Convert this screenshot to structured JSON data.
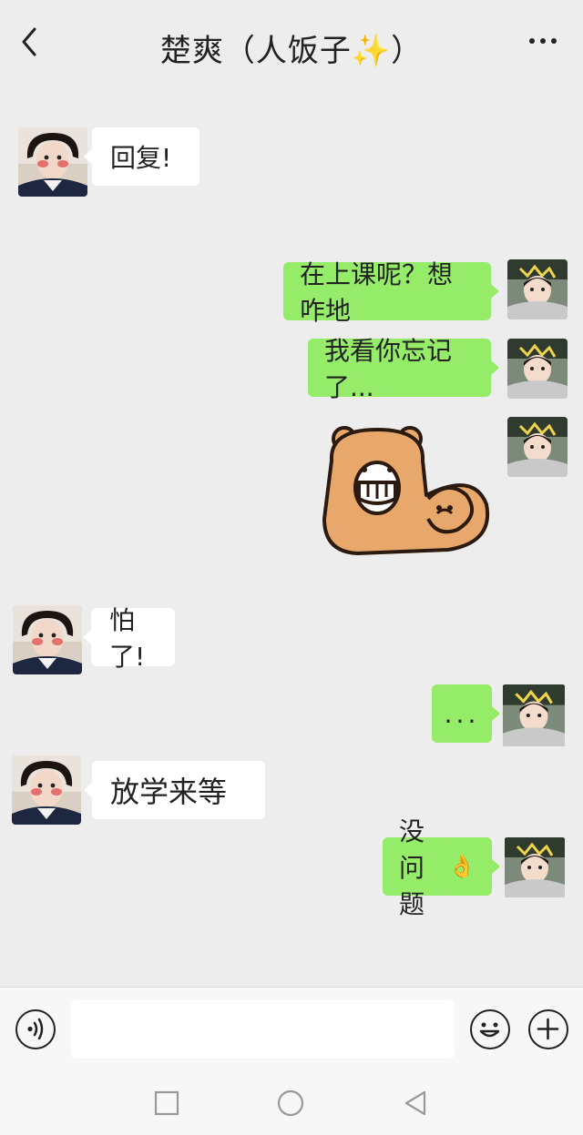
{
  "header": {
    "title": "楚爽（人饭子",
    "title_emoji": "✨",
    "title_close": "）"
  },
  "messages": [
    {
      "side": "left",
      "text": "回复!"
    },
    {
      "side": "right",
      "text": "在上课呢？想咋地"
    },
    {
      "side": "right",
      "text": "我看你忘记了..."
    },
    {
      "side": "right",
      "type": "sticker",
      "sticker": "bear-flexing-sticker"
    },
    {
      "side": "left",
      "text": "怕了!"
    },
    {
      "side": "right",
      "text": "..."
    },
    {
      "side": "left",
      "text": "放学来等"
    },
    {
      "side": "right",
      "text": "没问题",
      "emoji": "👌"
    }
  ],
  "input": {
    "value": "",
    "placeholder": ""
  },
  "colors": {
    "background": "#ededed",
    "bubble_self": "#95ec69",
    "bubble_other": "#ffffff",
    "bear_fur": "#e8a86c",
    "bear_dark": "#2b1a0f"
  },
  "icons": [
    "back-icon",
    "more-icon",
    "voice-icon",
    "emoji-icon",
    "plus-icon",
    "square-nav-icon",
    "circle-nav-icon",
    "triangle-nav-icon"
  ]
}
